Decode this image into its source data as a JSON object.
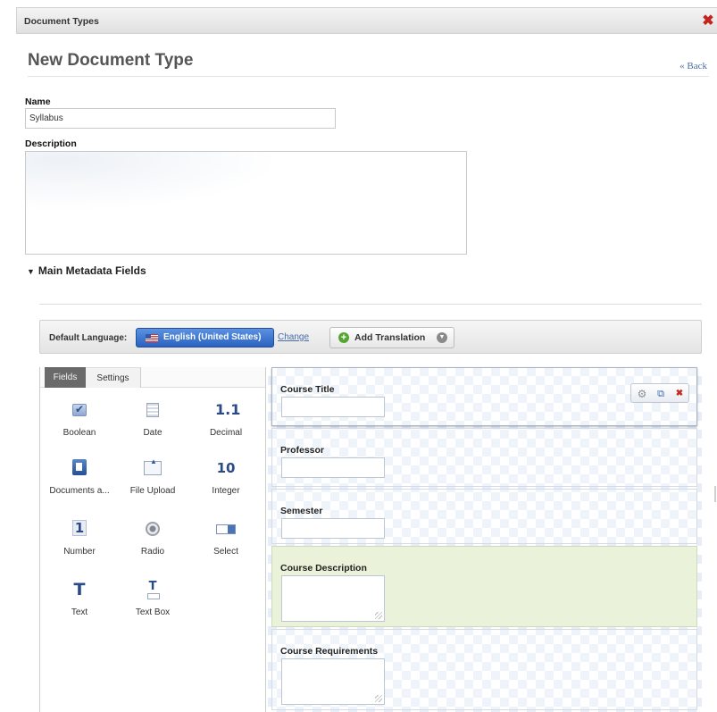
{
  "window": {
    "title": "Document Types",
    "close_label": "✖"
  },
  "page": {
    "title": "New Document Type",
    "back_label": "« Back"
  },
  "form": {
    "name_label": "Name",
    "name_value": "Syllabus",
    "description_label": "Description",
    "description_value": ""
  },
  "section": {
    "toggle": "▼",
    "title": "Main Metadata Fields"
  },
  "language_bar": {
    "label": "Default Language:",
    "language": "English (United States)",
    "change_label": "Change",
    "add_translation_label": "Add Translation"
  },
  "palette": {
    "tabs": [
      {
        "label": "Fields",
        "active": true
      },
      {
        "label": "Settings",
        "active": false
      }
    ],
    "field_types": [
      {
        "label": "Boolean",
        "icon": "checkbox-icon"
      },
      {
        "label": "Date",
        "icon": "calendar-icon",
        "glyph": ""
      },
      {
        "label": "Decimal",
        "icon": "decimal-icon",
        "glyph": "1.1"
      },
      {
        "label": "Documents a...",
        "icon": "documents-icon"
      },
      {
        "label": "File Upload",
        "icon": "upload-icon"
      },
      {
        "label": "Integer",
        "icon": "integer-icon",
        "glyph": "10"
      },
      {
        "label": "Number",
        "icon": "number-icon",
        "glyph": "1"
      },
      {
        "label": "Radio",
        "icon": "radio-icon"
      },
      {
        "label": "Select",
        "icon": "select-icon"
      },
      {
        "label": "Text",
        "icon": "text-icon",
        "glyph": "T"
      },
      {
        "label": "Text Box",
        "icon": "textbox-icon",
        "glyph": "T"
      }
    ]
  },
  "form_fields": [
    {
      "label": "Course Title",
      "kind": "input",
      "selected": true
    },
    {
      "label": "Professor",
      "kind": "input"
    },
    {
      "label": "Semester",
      "kind": "input"
    },
    {
      "label": "Course Description",
      "kind": "textarea",
      "highlighted": true
    },
    {
      "label": "Course Requirements",
      "kind": "textarea"
    }
  ],
  "colors": {
    "accent_blue": "#2a62c0",
    "close_red": "#c2241e",
    "highlight_green": "#eaf2da",
    "link": "#4a6ca8"
  }
}
